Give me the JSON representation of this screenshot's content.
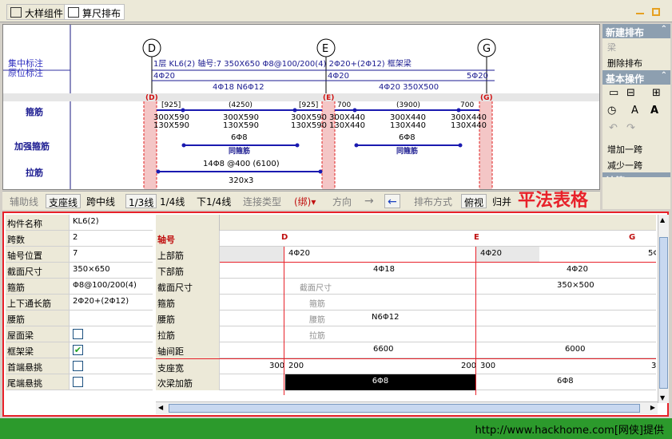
{
  "tabs": [
    {
      "label": "大样组件"
    },
    {
      "label": "算尺排布"
    }
  ],
  "canvas": {
    "left_labels": {
      "concentrated": "集中标注",
      "inplace": "原位标注",
      "stirrup": "箍筋",
      "reinforce_stirrup": "加强箍筋",
      "tie": "拉筋"
    },
    "axes": [
      "D",
      "E",
      "G"
    ],
    "axis_tags": [
      "(D)",
      "(E)",
      "(G)"
    ],
    "beam_note": "1层 KL6(2) 轴号:7 350X650 Φ8@100/200(4) 2Φ20+(2Φ12) 框架梁",
    "top_bars": [
      "4Φ20",
      "4Φ20",
      "5Φ20"
    ],
    "mid_bars": [
      "4Φ18  N6Φ12",
      "4Φ20  350X500"
    ],
    "dims_top": [
      "[925]",
      "(4250)",
      "[925]",
      "700",
      "(3900)",
      "700"
    ],
    "sections": [
      "300X590",
      "130X590",
      "300X590",
      "130X590",
      "300X590",
      "130X590",
      "300X440",
      "130X440",
      "300X440",
      "130X440",
      "300X440",
      "130X440"
    ],
    "reinf": [
      "6Φ8",
      "同箍筋",
      "6Φ8",
      "同箍筋"
    ],
    "tie": "14Φ8 @400 (6100)",
    "tie2": "320x3"
  },
  "side": {
    "h1": "新建排布",
    "i1": "梁",
    "i2": "删除排布",
    "h2": "基本操作",
    "i3": "增加一跨",
    "i4": "减少一跨",
    "h3": "计算"
  },
  "toolbar": {
    "b1": "辅助线",
    "b2": "支座线",
    "b3": "跨中线",
    "b4": "1/3线",
    "b5": "1/4线",
    "b6": "下1/4线",
    "b7": "连接类型",
    "b8": "(绑)",
    "b9": "方向",
    "b10": "排布方式",
    "b11": "俯视",
    "b12": "归并"
  },
  "title": "平法表格",
  "props": [
    {
      "k": "构件名称",
      "v": "KL6(2)"
    },
    {
      "k": "跨数",
      "v": "2"
    },
    {
      "k": "轴号位置",
      "v": "7"
    },
    {
      "k": "截面尺寸",
      "v": "350×650"
    },
    {
      "k": "箍筋",
      "v": "Φ8@100/200(4)"
    },
    {
      "k": "上下通长筋",
      "v": "2Φ20+(2Φ12)"
    },
    {
      "k": "腰筋",
      "v": ""
    },
    {
      "k": "屋面梁",
      "check": false
    },
    {
      "k": "框架梁",
      "check": true
    },
    {
      "k": "首端悬挑",
      "check": false
    },
    {
      "k": "尾端悬挑",
      "check": false
    }
  ],
  "grid": {
    "axis_label": "轴号",
    "axis_d": "D",
    "axis_e": "E",
    "axis_g": "G",
    "r1": "上部筋",
    "r1v": [
      "4Φ20",
      "4Φ20",
      "5Φ"
    ],
    "r2": "下部筋",
    "r2v": [
      "4Φ18",
      "4Φ20"
    ],
    "r3": "截面尺寸",
    "r3v": [
      "截面尺寸",
      "350×500"
    ],
    "r4": "箍筋",
    "r4v": "箍筋",
    "r5": "腰筋",
    "r5v": [
      "腰筋",
      "N6Φ12"
    ],
    "r6": "拉筋",
    "r6v": "拉筋",
    "r7": "轴间距",
    "r7v": [
      "6600",
      "6000"
    ],
    "r8": "支座宽",
    "r8v": [
      "300",
      "200",
      "200",
      "300",
      "3"
    ],
    "r9": "次梁加筋",
    "r9v": [
      "6Φ8",
      "6Φ8"
    ]
  },
  "status": "http://www.hackhome.com[网侠]提供"
}
